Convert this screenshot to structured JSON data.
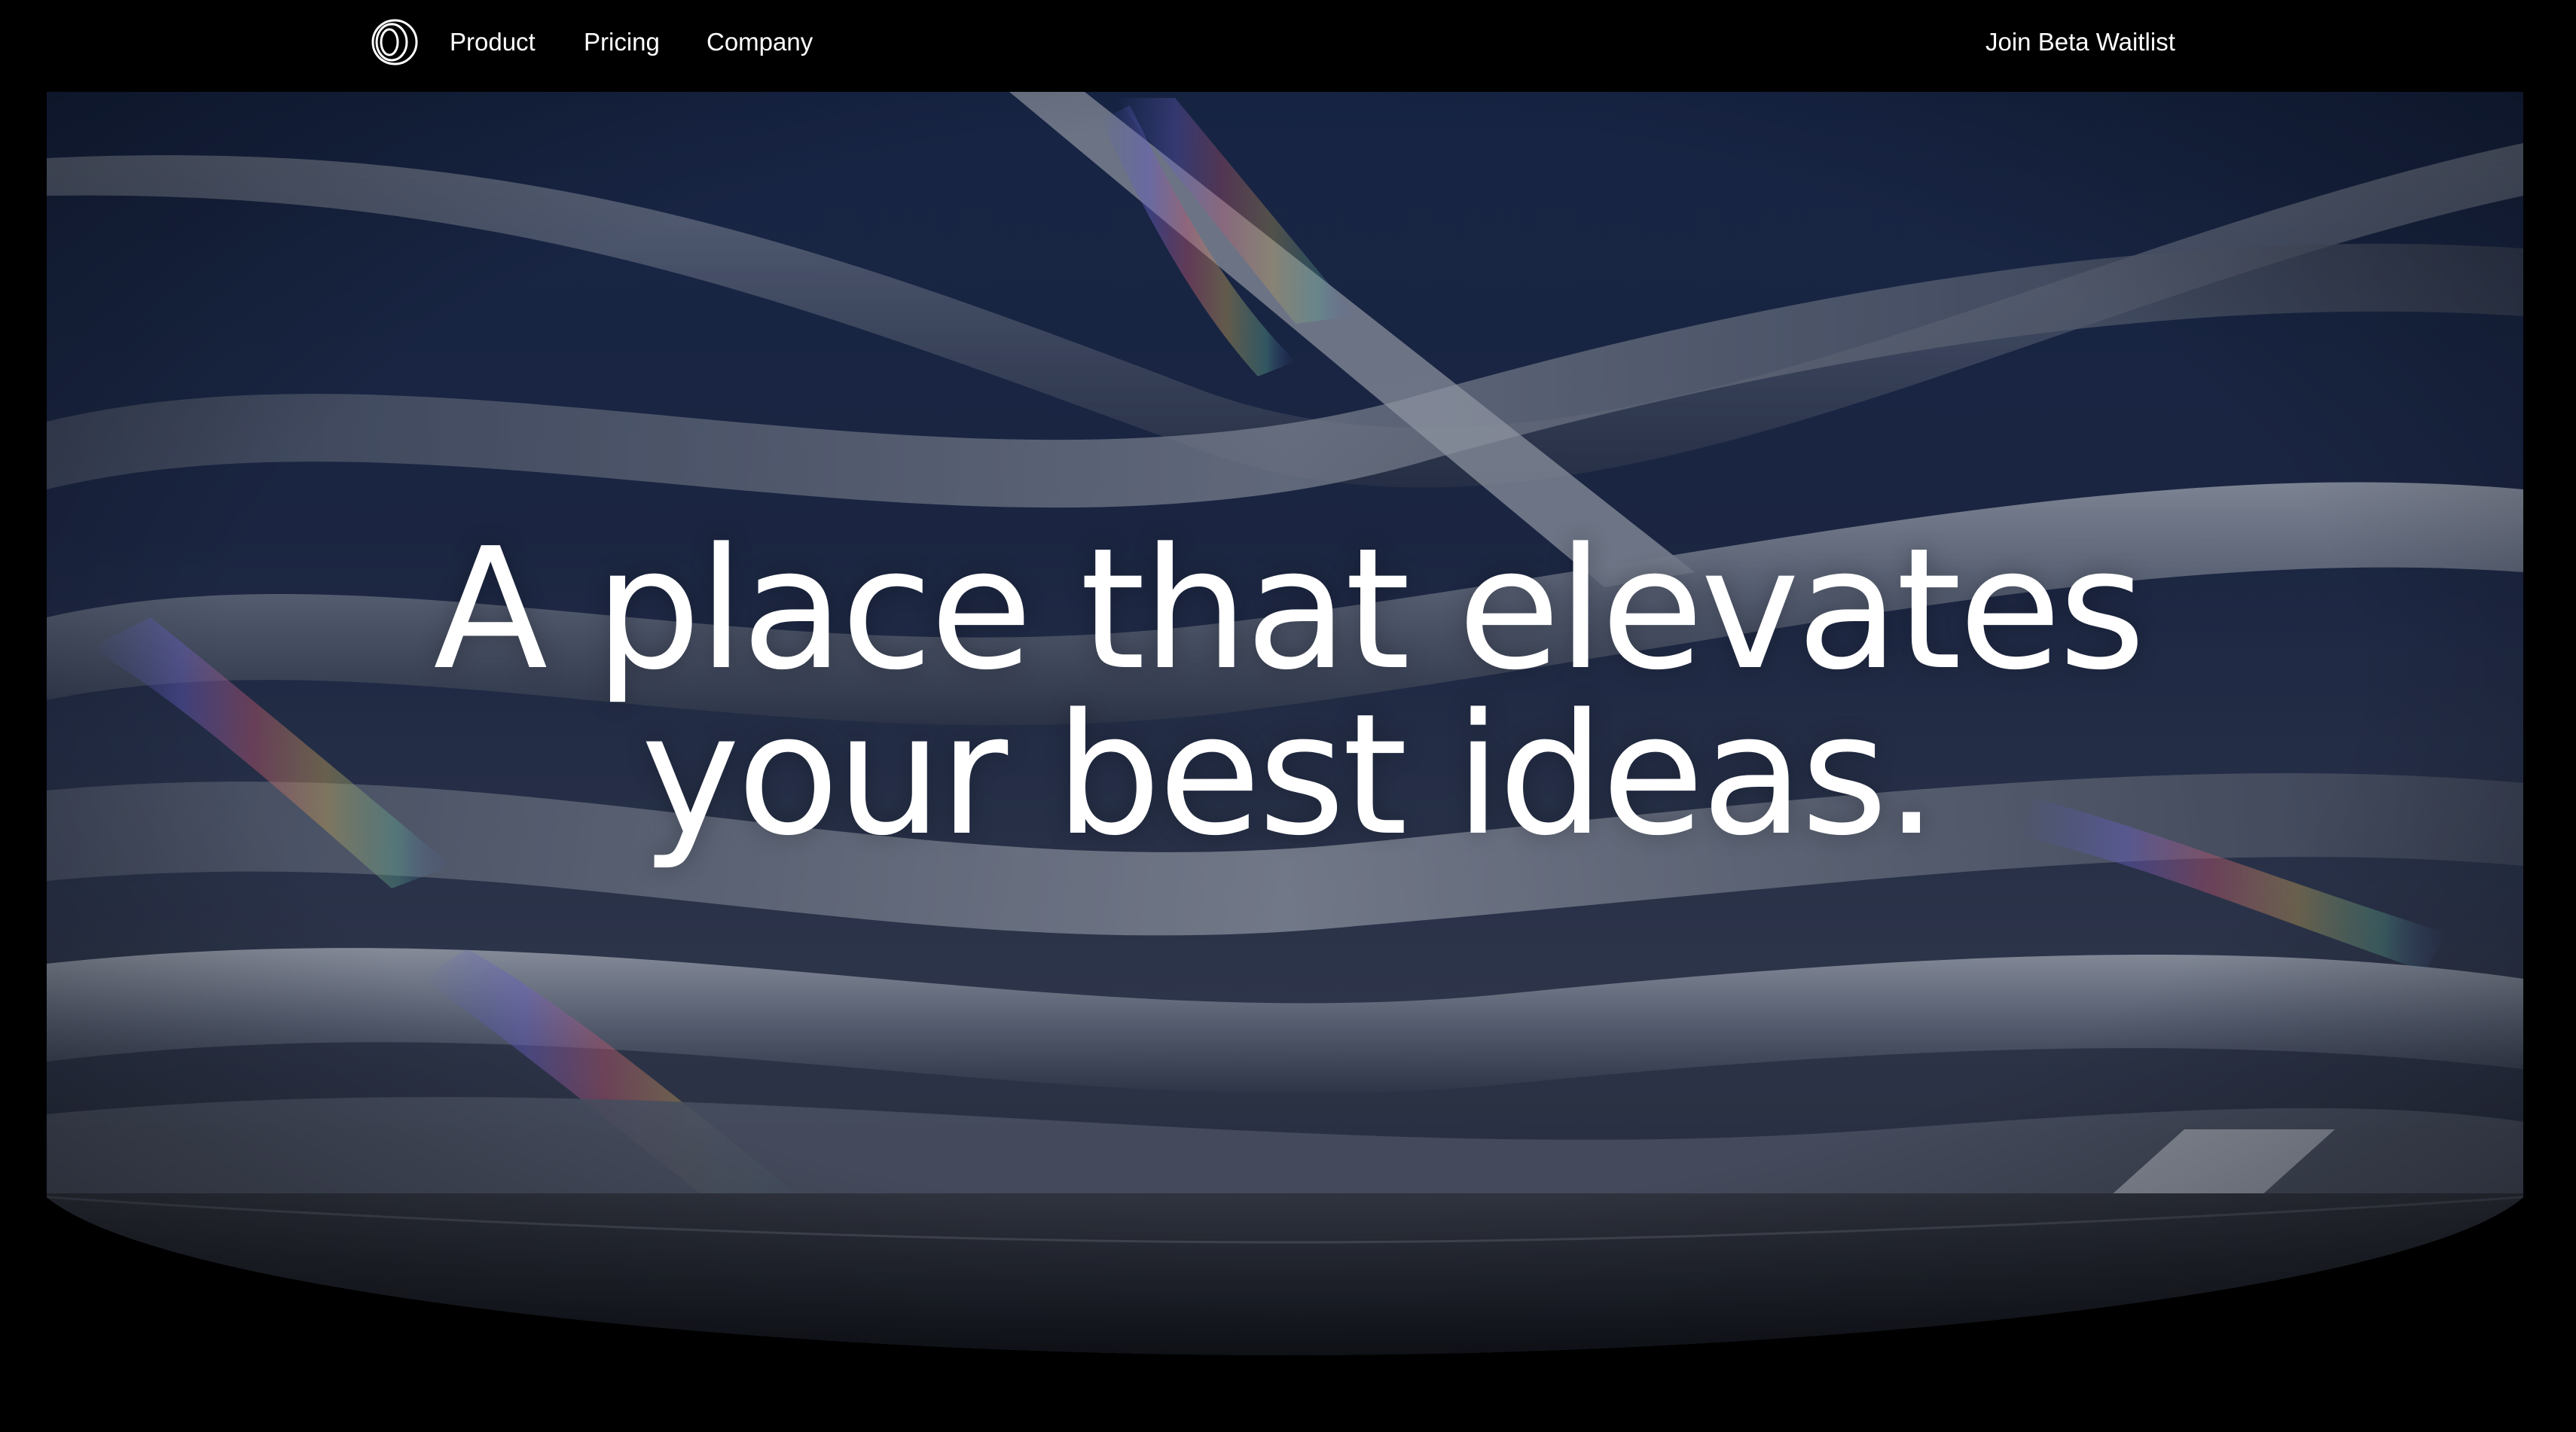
{
  "brand": {
    "logo_icon": "concentric-rings-logo-icon"
  },
  "nav": {
    "links": [
      {
        "label": "Product"
      },
      {
        "label": "Pricing"
      },
      {
        "label": "Company"
      }
    ],
    "cta_label": "Join Beta Waitlist"
  },
  "hero": {
    "headline_line1": "A place that elevates",
    "headline_line2": "your best ideas.",
    "background": "abstract-glass-ribbons-image"
  },
  "colors": {
    "page_background": "#000000",
    "text": "#ffffff",
    "hero_tint": "#1b2b4f"
  }
}
